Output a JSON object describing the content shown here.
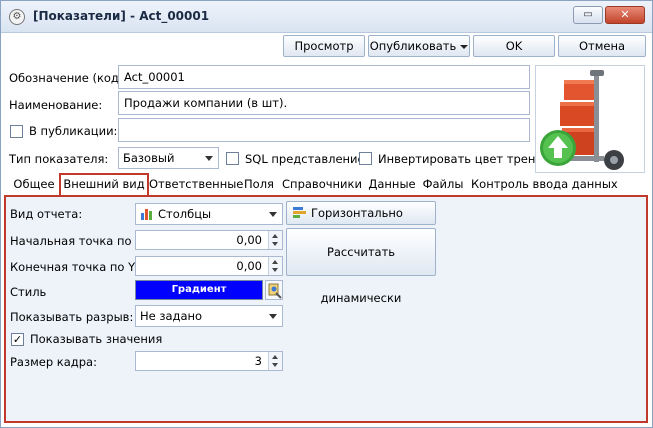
{
  "window": {
    "title": "[Показатели] - Act_00001",
    "restore_icon": "restore-icon",
    "close_icon": "close-icon"
  },
  "toolbar": {
    "preview": "Просмотр",
    "publish": "Опубликовать",
    "ok": "OK",
    "cancel": "Отмена"
  },
  "form": {
    "code_label": "Обозначение (код):",
    "code_value": "Act_00001",
    "name_label": "Наименование:",
    "name_value": "Продажи компании (в шт).",
    "publication_label": "В публикации:",
    "publication_value": "",
    "type_label": "Тип показателя:",
    "type_value": "Базовый",
    "sql_label": "SQL представление",
    "invert_label": "Инвертировать цвет тренда"
  },
  "tabs": [
    {
      "label": "Общее"
    },
    {
      "label": "Внешний вид"
    },
    {
      "label": "Ответственные"
    },
    {
      "label": "Поля"
    },
    {
      "label": "Справочники"
    },
    {
      "label": "Данные"
    },
    {
      "label": "Файлы"
    },
    {
      "label": "Контроль ввода данных"
    }
  ],
  "appearance": {
    "report_type_label": "Вид отчета:",
    "report_type_value": "Столбцы",
    "horizontal_button": "Горизонтально",
    "start_label": "Начальная точка по Y:",
    "start_value": "0,00",
    "end_label": "Конечная точка по Y:",
    "end_value": "0,00",
    "calc_button": "Рассчитать динамически",
    "style_label": "Стиль",
    "style_value": "Градиент",
    "style_color": "#0000ff",
    "gap_label": "Показывать разрыв:",
    "gap_value": "Не задано",
    "show_values_label": "Показывать значения",
    "frame_label": "Размер кадра:",
    "frame_value": "3"
  }
}
